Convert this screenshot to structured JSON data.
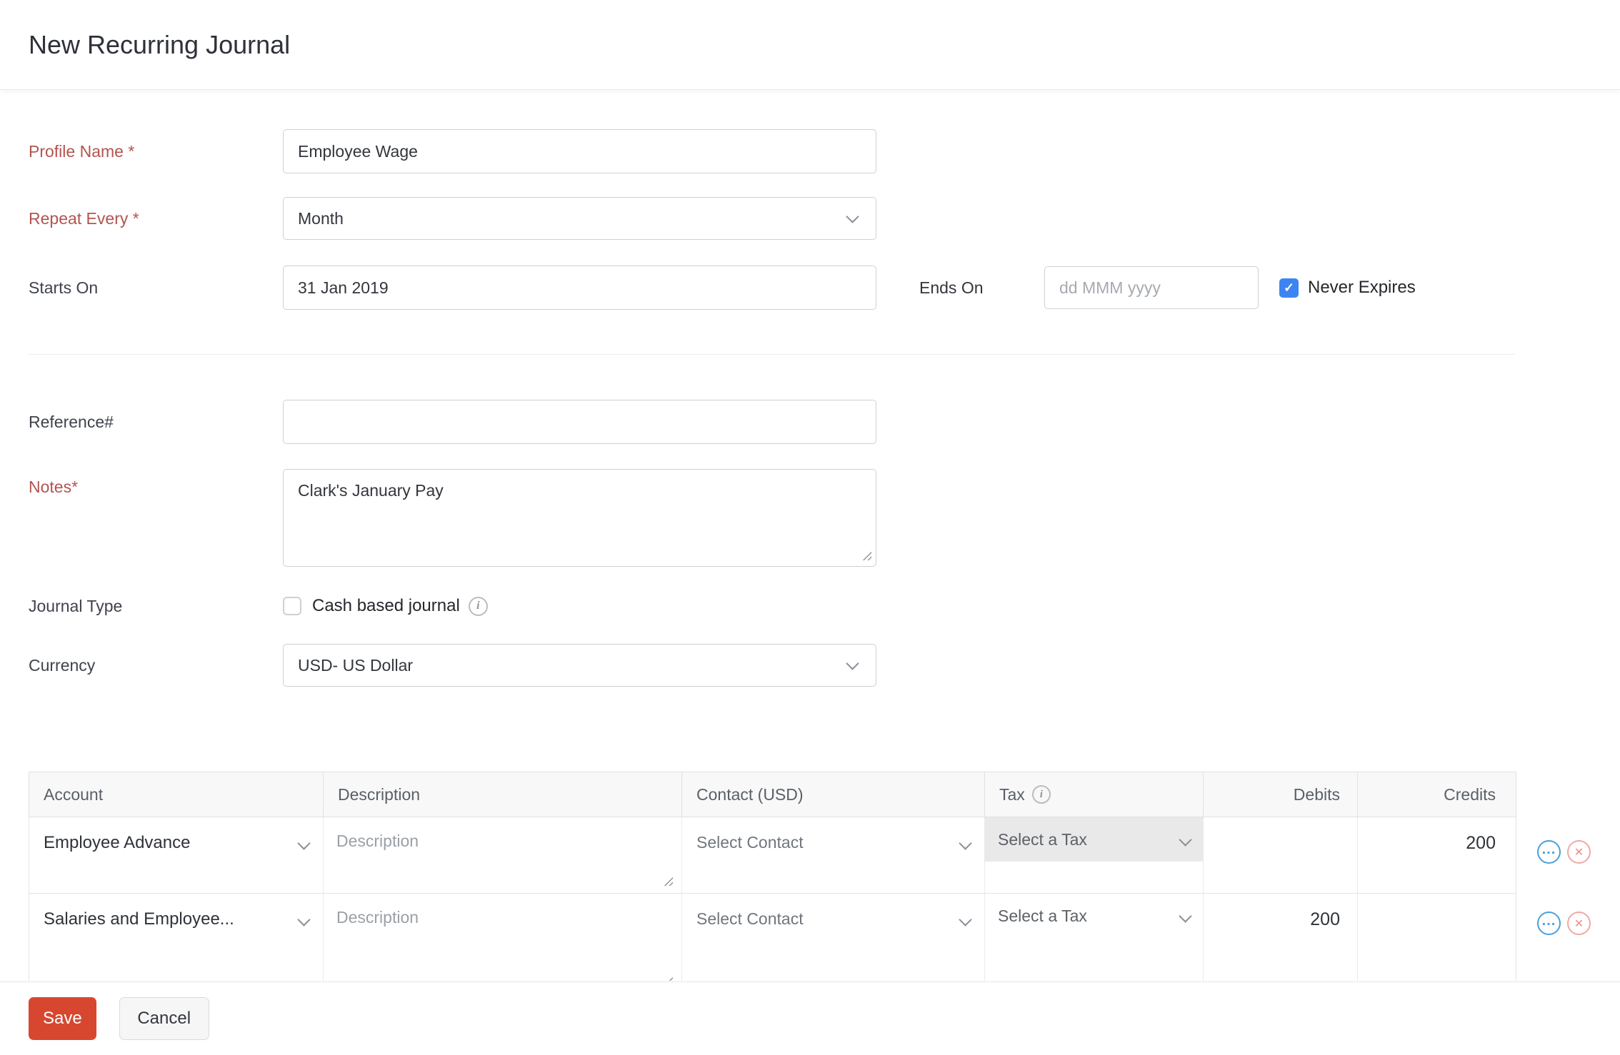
{
  "header": {
    "title": "New Recurring Journal"
  },
  "form": {
    "profile_name": {
      "label": "Profile Name *",
      "value": "Employee Wage"
    },
    "repeat_every": {
      "label": "Repeat Every *",
      "value": "Month"
    },
    "starts_on": {
      "label": "Starts On",
      "value": "31 Jan 2019"
    },
    "ends_on": {
      "label": "Ends On",
      "placeholder": "dd MMM yyyy",
      "value": ""
    },
    "never_expires": {
      "label": "Never Expires",
      "checked": true
    },
    "reference": {
      "label": "Reference#",
      "value": ""
    },
    "notes": {
      "label": "Notes*",
      "value": "Clark's January Pay"
    },
    "journal_type": {
      "label": "Journal Type",
      "checkbox_label": "Cash based journal",
      "checked": false
    },
    "currency": {
      "label": "Currency",
      "value": "USD- US Dollar"
    }
  },
  "table": {
    "columns": [
      "Account",
      "Description",
      "Contact (USD)",
      "Tax",
      "Debits",
      "Credits"
    ],
    "rows": [
      {
        "account": "Employee Advance",
        "description_placeholder": "Description",
        "contact": "Select Contact",
        "tax": "Select a Tax",
        "debits": "",
        "credits": "200"
      },
      {
        "account": "Salaries and Employee...",
        "description_placeholder": "Description",
        "contact": "Select Contact",
        "tax": "Select a Tax",
        "debits": "200",
        "credits": ""
      }
    ]
  },
  "footer": {
    "save_label": "Save",
    "cancel_label": "Cancel"
  },
  "icons": {
    "more_options": "...",
    "remove_row": "✕",
    "info": "i",
    "checkmark": "✓"
  },
  "colors": {
    "required_label": "#b3544f",
    "save_button": "#d7472f",
    "checkbox_checked_blue": "#3c84f2",
    "row_action_blue": "#49a0dd",
    "row_action_pink": "#f2a7a5",
    "table_header_bg": "#f8f8f9",
    "tax_cell_bg": "#e9e9ea"
  }
}
